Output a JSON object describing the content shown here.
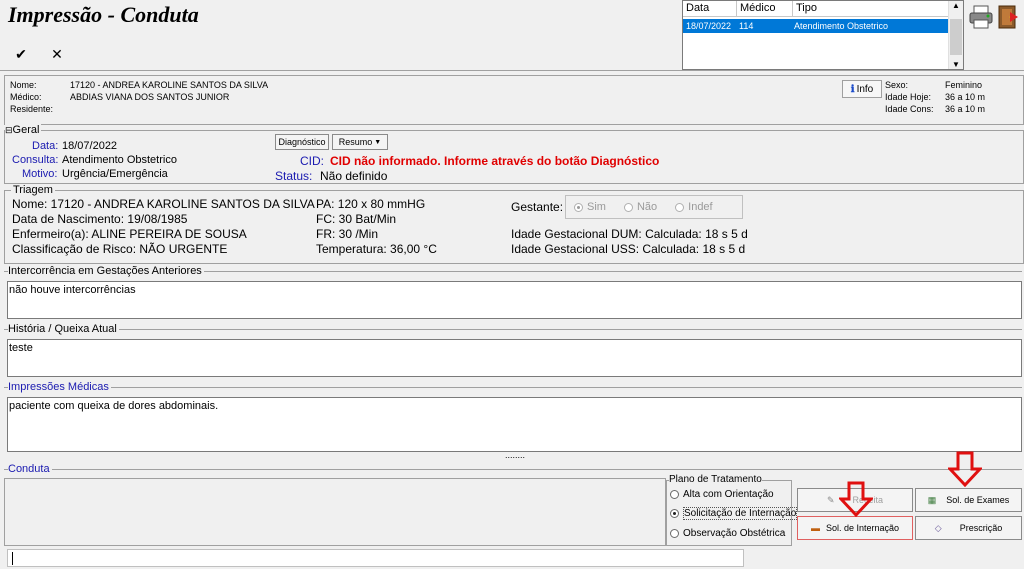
{
  "header": {
    "title": "Impressão - Conduta",
    "confirm_icon": "check-icon",
    "cancel_icon": "close-icon"
  },
  "appointments": {
    "columns": [
      "Data",
      "Médico",
      "Tipo"
    ],
    "rows": [
      {
        "data": "18/07/2022",
        "medico": "114",
        "tipo": "Atendimento Obstetrico"
      }
    ]
  },
  "patient": {
    "nome_label": "Nome:",
    "nome": "17120 - ANDREA  KAROLINE SANTOS DA SILVA",
    "medico_label": "Médico:",
    "medico": "ABDIAS VIANA DOS SANTOS JUNIOR",
    "residente_label": "Residente:",
    "info_label": "Info",
    "sexo_label": "Sexo:",
    "sexo": "Feminino",
    "idade_hoje_label": "Idade Hoje:",
    "idade_hoje": "36 a 10 m",
    "idade_cons_label": "Idade Cons:",
    "idade_cons": "36 a 10 m"
  },
  "geral": {
    "legend": "Geral",
    "data_label": "Data:",
    "data": "18/07/2022",
    "consulta_label": "Consulta:",
    "consulta": "Atendimento Obstetrico",
    "motivo_label": "Motivo:",
    "motivo": "Urgência/Emergência",
    "diagnostico_btn": "Diagnóstico",
    "resumo_btn": "Resumo",
    "cid_label": "CID:",
    "cid": "CID não informado. Informe através do botão Diagnóstico",
    "status_label": "Status:",
    "status": "Não definido"
  },
  "triagem": {
    "legend": "Triagem",
    "nome": "Nome: 17120 - ANDREA  KAROLINE SANTOS DA SILVA",
    "nascimento": "Data de Nascimento: 19/08/1985",
    "enfermeiro": "Enfermeiro(a): ALINE PEREIRA DE SOUSA",
    "risco": "Classificação de Risco: NÃO URGENTE",
    "pa": "PA: 120  x 80    mmHG",
    "fc": "FC: 30    Bat/Min",
    "fr": "FR: 30    /Min",
    "temperatura": "Temperatura: 36,00  °C",
    "gestante_label": "Gestante:",
    "gestante_options": [
      "Sim",
      "Não",
      "Indef"
    ],
    "dum": "Idade Gestacional DUM: Calculada: 18 s 5 d",
    "uss": "Idade Gestacional USS: Calculada: 18 s 5 d"
  },
  "intercorrencia": {
    "legend": "Intercorrência em Gestações Anteriores",
    "value": "não houve intercorrências"
  },
  "historia": {
    "legend": "História / Queixa Atual",
    "value": "teste"
  },
  "impressoes": {
    "legend": "Impressões Médicas",
    "value": "paciente com queixa de dores abdominais.",
    "splitter": "........"
  },
  "conduta": {
    "legend": "Conduta",
    "plano_legend": "Plano de Tratamento",
    "plano_options": [
      "Alta com Orientação",
      "Solicitação de Internação",
      "Observação Obstétrica"
    ],
    "receita_btn": "Receita",
    "sol_exames_btn": "Sol. de Exames",
    "sol_internacao_btn": "Sol. de Internação",
    "prescricao_btn": "Prescrição"
  }
}
